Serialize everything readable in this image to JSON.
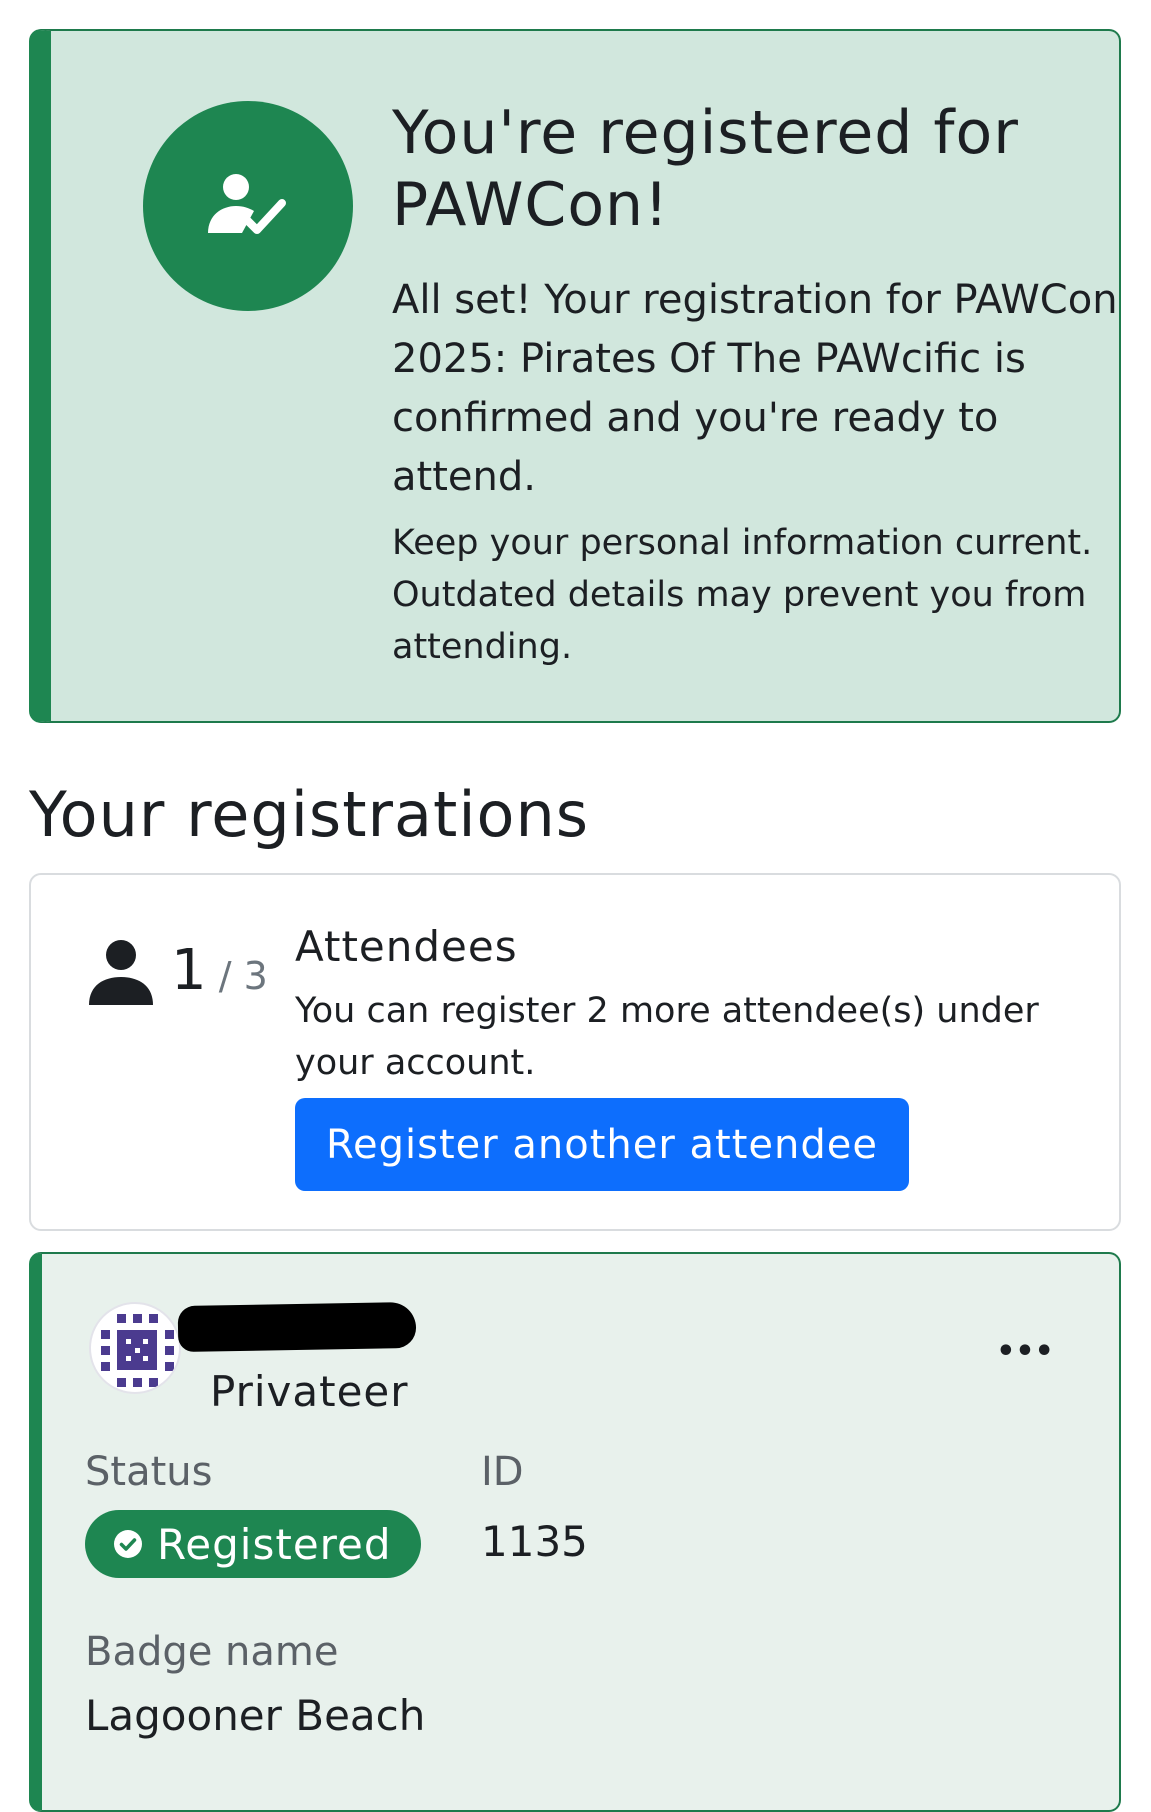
{
  "alert": {
    "title": "You're registered for PAWCon!",
    "body": "All set! Your registration for PAWCon 2025: Pirates Of The PAWcific is confirmed and you're ready to attend.",
    "note": "Keep your personal information current. Outdated details may prevent you from attending.",
    "icon": "user-check-icon",
    "color": "#1e8651",
    "background": "#d1e7dd"
  },
  "registrations": {
    "heading": "Your registrations"
  },
  "attendees": {
    "count": "1",
    "separator": "/",
    "total": "3",
    "title": "Attendees",
    "description": "You can register 2 more attendee(s) under your account.",
    "button_label": "Register another attendee",
    "button_color": "#0d6efd",
    "icon": "person-icon"
  },
  "registration_card": {
    "avatar_icon": "pixel-avatar-icon",
    "tier": "Privateer",
    "more_icon": "more-options-icon",
    "more_label": "•••",
    "status_label": "Status",
    "status_value": "Registered",
    "id_label": "ID",
    "id_value": "1135",
    "badge_name_label": "Badge name",
    "badge_name_value": "Lagooner Beach"
  }
}
